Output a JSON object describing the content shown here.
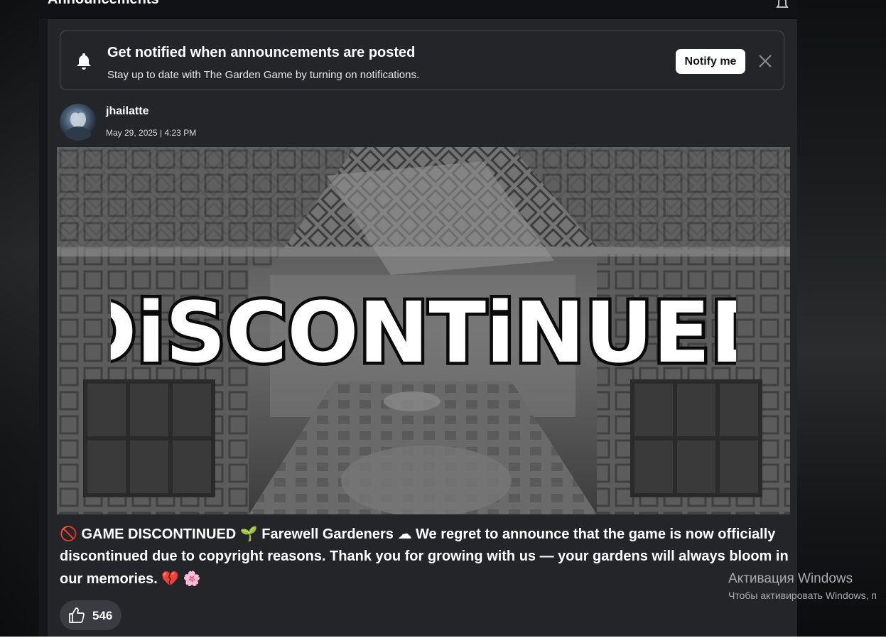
{
  "section": {
    "title": "Announcements"
  },
  "notify_banner": {
    "title": "Get notified when announcements are posted",
    "subtitle": "Stay up to date with The Garden Game by turning on notifications.",
    "button_label": "Notify me",
    "icon": "bell-icon",
    "close_icon": "close-icon"
  },
  "post": {
    "author": "jhailatte",
    "date": "May 29, 2025 | 4:23 PM",
    "banner_text": "DiSCONTiNUED",
    "body_parts": [
      {
        "emoji": "🚫"
      },
      {
        "text": " GAME DISCONTINUED "
      },
      {
        "emoji": "🌱"
      },
      {
        "text": " Farewell Gardeners "
      },
      {
        "emoji": "☁"
      },
      {
        "text": " We regret to announce that the game is now officially discontinued due to copyright reasons. Thank you for growing with us — your gardens will always bloom in our memories. "
      },
      {
        "emoji": "💔"
      },
      {
        "text": " "
      },
      {
        "emoji": "🌸"
      }
    ],
    "likes": "546",
    "like_icon": "thumbs-up-icon"
  },
  "os_overlay": {
    "title": "Активация Windows",
    "subtitle": "Чтобы активировать Windows, п"
  },
  "colors": {
    "panel": "#232529",
    "card_border": "#4a4d53",
    "button_bg": "#ffffff",
    "pill_bg": "#3a3c42"
  }
}
